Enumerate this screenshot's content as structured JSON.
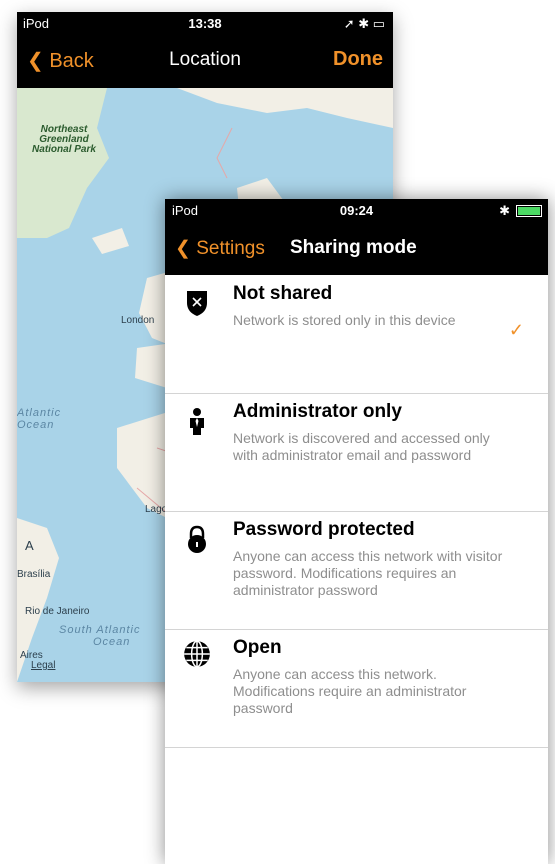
{
  "back_screen": {
    "status": {
      "carrier": "iPod",
      "time": "13:38"
    },
    "nav": {
      "back_label": "Back",
      "title": "Location",
      "done_label": "Done"
    },
    "map_labels": {
      "park": "Northeast Greenland National Park",
      "london": "London",
      "atlantic": "Atlantic",
      "ocean": "Ocean",
      "lagos": "Lagos",
      "marker": "A",
      "brasilia": "Brasília",
      "rio": "Rio de Janeiro",
      "south_atlantic": "South Atlantic",
      "south_ocean": "Ocean",
      "aires": "Aires",
      "legal": "Legal"
    }
  },
  "front_screen": {
    "status": {
      "carrier": "iPod",
      "time": "09:24"
    },
    "nav": {
      "back_label": "Settings",
      "title": "Sharing mode"
    },
    "options": [
      {
        "title": "Not shared",
        "description": "Network is stored only in this device",
        "icon": "shield-x-icon",
        "selected": true
      },
      {
        "title": "Administrator only",
        "description": "Network is discovered and accessed only with administrator email and password",
        "icon": "person-icon",
        "selected": false
      },
      {
        "title": "Password protected",
        "description": "Anyone can access this network with visitor password. Modifications requires an administrator password",
        "icon": "lock-icon",
        "selected": false
      },
      {
        "title": "Open",
        "description": "Anyone can access this network. Modifications require an administrator password",
        "icon": "globe-icon",
        "selected": false
      }
    ]
  },
  "colors": {
    "accent": "#f0912a",
    "nav_bg": "#000000",
    "ocean": "#a9d3e8",
    "land": "#f2efe6"
  }
}
